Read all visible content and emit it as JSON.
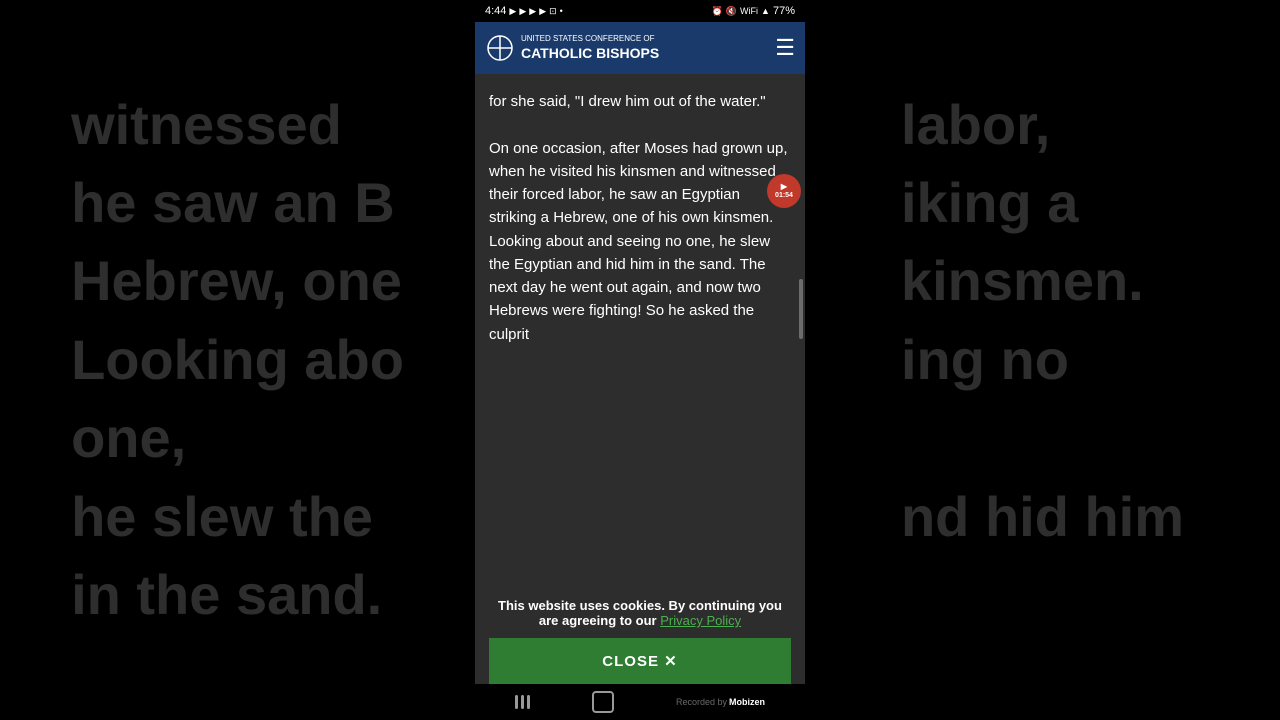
{
  "status_bar": {
    "time": "4:44",
    "icons": [
      "youtube",
      "youtube",
      "youtube",
      "youtube",
      "cast",
      "dot"
    ],
    "right_icons": [
      "alarm",
      "mute",
      "wifi",
      "signal",
      "battery"
    ],
    "battery": "77%"
  },
  "nav": {
    "org_line1": "UNITED STATES CONFERENCE OF",
    "org_line2": "CATHOLIC BISHOPS",
    "menu_icon": "☰"
  },
  "scripture": {
    "paragraph1": "for she said, \"I drew him out of the water.\"",
    "paragraph2": "On one occasion, after Moses had grown up, when he visited his kinsmen and witnessed their forced labor, he saw an Egyptian striking a Hebrew, one of his own kinsmen. Looking about and seeing no one, he slew the Egyptian and hid him in the sand. The next day he went out again, and now two Hebrews were fighting! So he asked the culprit"
  },
  "timer": {
    "value": "01:54"
  },
  "cookie_banner": {
    "message": "This website uses cookies. By continuing you are agreeing to our ",
    "link_text": "Privacy Policy",
    "close_label": "CLOSE  ✕"
  },
  "bg_left": {
    "lines": [
      "witnessed",
      "he saw an B",
      "Hebrew, one",
      "Looking abo",
      "one,",
      "he slew the",
      "in the sand."
    ]
  },
  "bg_right": {
    "lines": [
      "labor,",
      "iking a",
      "kinsmen.",
      "ing no",
      "",
      "nd hid him",
      ""
    ]
  },
  "bottom": {
    "recorded_label": "Recorded by",
    "brand": "Mobizen"
  }
}
